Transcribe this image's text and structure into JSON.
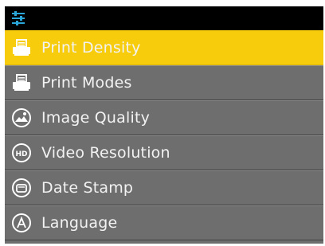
{
  "colors": {
    "selected_bg": "#f7cc0c",
    "item_bg": "#6e6e6e",
    "text": "#f2f2f2",
    "topbar_bg": "#000000",
    "accent": "#2aa7d8"
  },
  "topbar": {
    "icon": "settings-sliders-icon"
  },
  "menu": {
    "items": [
      {
        "label": "Print Density",
        "icon": "printer-icon",
        "selected": true
      },
      {
        "label": "Print Modes",
        "icon": "printer-icon",
        "selected": false
      },
      {
        "label": "Image Quality",
        "icon": "landscape-image-icon",
        "selected": false
      },
      {
        "label": "Video Resolution",
        "icon": "hd-icon",
        "selected": false
      },
      {
        "label": "Date Stamp",
        "icon": "date-stamp-icon",
        "selected": false
      },
      {
        "label": "Language",
        "icon": "language-a-icon",
        "selected": false
      }
    ]
  }
}
